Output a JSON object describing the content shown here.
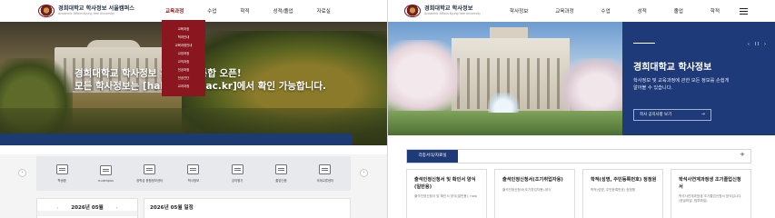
{
  "left": {
    "logo": {
      "main": "경희대학교 학사정보 서울캠퍼스",
      "sub": "Academic Affairs Kyung Hee University"
    },
    "nav": [
      "교육과정",
      "수업",
      "학적",
      "성적/졸업",
      "자료실"
    ],
    "dropdown": [
      "교육과정",
      "학과안내",
      "교육과정안내",
      "교양과정",
      "교직과정",
      "전공과정",
      "전공진단",
      "교과과정"
    ],
    "hero_line1": "경희대학교 학사정보 홈페이지 통합 오픈!",
    "hero_line2": "모든 학사정보는 [haksa.khu.ac.kr]에서 확인 가능합니다.",
    "quick_menu": [
      "학생증",
      "e-campus",
      "장학금 종합정보센터",
      "학사정보",
      "강의평가",
      "졸업인증",
      "국제교류센터"
    ],
    "calendar_title": "2026년 05월",
    "schedule_title": "2026년 05월 일정",
    "arrow_prev": "‹",
    "arrow_next": "›"
  },
  "right": {
    "logo": {
      "main": "경희대학교 학사정보",
      "sub": "Academic Affairs Kyung Hee University"
    },
    "nav": [
      "학사정보",
      "교육과정",
      "수업",
      "성적",
      "졸업",
      "학적"
    ],
    "panel": {
      "controls": "‹ II ›",
      "title": "경희대학교 학사정보",
      "desc": "학사정보 및 교육과정에 관한 모든 정보를 손쉽게 알아볼 수 있습니다.",
      "button": "학사 공지사항 보기",
      "button_arrow": "→"
    },
    "tab": "각종서식/자료실",
    "tab_plus": "+",
    "cards": [
      {
        "title": "출석인정신청서 및 확인서 양식(일반용)",
        "desc": "출석인정신청서 및 확인서 양식(일반용), hwp"
      },
      {
        "title": "출석인정신청서(조기취업자용)",
        "desc": "출석인정신청서(조기취업자용) 양식"
      },
      {
        "title": "학적(성명, 주민등록번호) 정정원",
        "desc": "학적(성명, 주민등록번호) 정정원"
      },
      {
        "title": "학석사연계과정생 조기졸업신청서",
        "desc": "학석사연계과정생 조기졸업신청서 양식입니다. (한글파일, 첨부파일)"
      }
    ]
  },
  "colors": {
    "navy": "#1e3a78",
    "crimson": "#8a1720",
    "quick_bg": "#e7e9ec"
  }
}
